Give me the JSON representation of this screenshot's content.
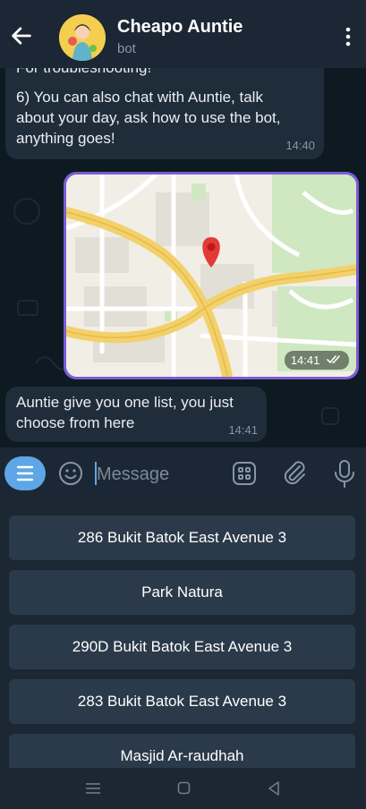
{
  "header": {
    "title": "Cheapo Auntie",
    "subtitle": "bot",
    "back_icon": "arrow-left-icon",
    "menu_icon": "more-vertical-icon"
  },
  "messages": {
    "msg1": {
      "lines": [
        "For troubleshooting!",
        "6) You can also chat with Auntie, talk",
        "about your day, ask how to use the bot,",
        "anything goes!"
      ],
      "time": "14:40"
    },
    "map": {
      "time": "14:41",
      "status_icon": "double-check-icon"
    },
    "msg2": {
      "lines": [
        "Auntie give you one list, you just",
        "choose from here"
      ],
      "time": "14:41"
    }
  },
  "input": {
    "placeholder": "Message"
  },
  "keyboard": {
    "buttons": [
      "286 Bukit Batok East Avenue 3",
      "Park Natura",
      "290D Bukit Batok East Avenue 3",
      "283 Bukit Batok East Avenue 3",
      "Masjid Ar-raudhah"
    ]
  },
  "colors": {
    "accent": "#5ea6e6",
    "header_bg": "#1b2734",
    "chat_bg": "#0e1a22",
    "bubble_in": "#1f2c39",
    "button_bg": "#2b3a4a",
    "map_border": "#7a5cd6"
  }
}
